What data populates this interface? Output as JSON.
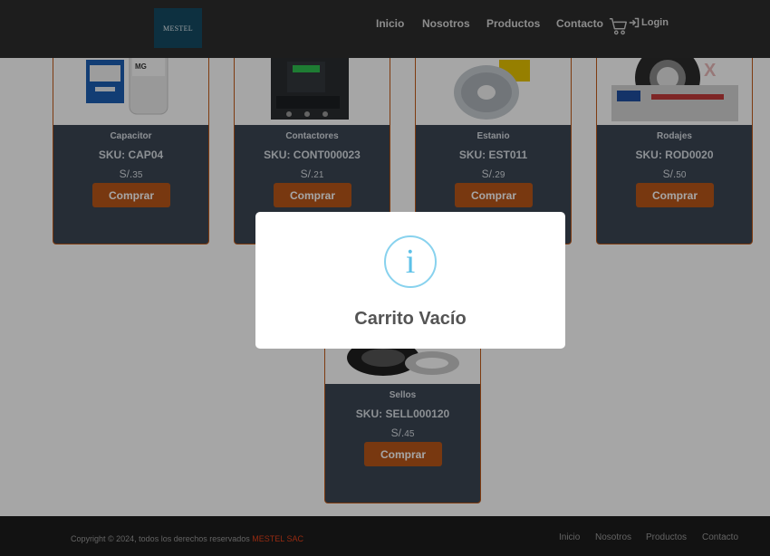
{
  "header": {
    "logo_text": "MESTEL",
    "nav": [
      "Inicio",
      "Nosotros",
      "Productos",
      "Contacto"
    ],
    "login_label": "Login"
  },
  "products": [
    {
      "name": "Capacitor",
      "sku": "SKU: CAP04",
      "currency": "S/.",
      "price": "35",
      "button": "Comprar"
    },
    {
      "name": "Contactores",
      "sku": "SKU: CONT000023",
      "currency": "S/.",
      "price": "21",
      "button": "Comprar"
    },
    {
      "name": "Estanio",
      "sku": "SKU: EST011",
      "currency": "S/.",
      "price": "29",
      "button": "Comprar"
    },
    {
      "name": "Rodajes",
      "sku": "SKU: ROD0020",
      "currency": "S/.",
      "price": "50",
      "button": "Comprar"
    },
    {
      "name": "Sellos",
      "sku": "SKU: SELL000120",
      "currency": "S/.",
      "price": "45",
      "button": "Comprar"
    }
  ],
  "modal": {
    "icon": "info-icon",
    "icon_glyph": "i",
    "title": "Carrito Vacío"
  },
  "footer": {
    "copyright": "Copyright © 2024, todos los derechos reservados",
    "brand": "MESTEL SAC",
    "links": [
      "Inicio",
      "Nosotros",
      "Productos",
      "Contacto"
    ]
  },
  "colors": {
    "header_bg": "#2d2d2d",
    "card_bg": "#3b4654",
    "accent": "#b9561a",
    "brand": "#e3411b",
    "info": "#88d2ee"
  }
}
